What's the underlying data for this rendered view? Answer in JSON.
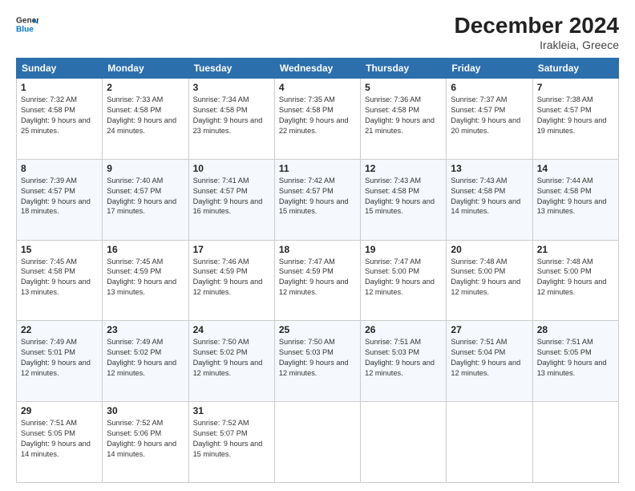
{
  "header": {
    "logo_general": "General",
    "logo_blue": "Blue",
    "title": "December 2024",
    "subtitle": "Irakleia, Greece"
  },
  "days_of_week": [
    "Sunday",
    "Monday",
    "Tuesday",
    "Wednesday",
    "Thursday",
    "Friday",
    "Saturday"
  ],
  "weeks": [
    [
      {
        "day": 1,
        "sunrise": "7:32 AM",
        "sunset": "4:58 PM",
        "daylight": "9 hours and 25 minutes."
      },
      {
        "day": 2,
        "sunrise": "7:33 AM",
        "sunset": "4:58 PM",
        "daylight": "9 hours and 24 minutes."
      },
      {
        "day": 3,
        "sunrise": "7:34 AM",
        "sunset": "4:58 PM",
        "daylight": "9 hours and 23 minutes."
      },
      {
        "day": 4,
        "sunrise": "7:35 AM",
        "sunset": "4:58 PM",
        "daylight": "9 hours and 22 minutes."
      },
      {
        "day": 5,
        "sunrise": "7:36 AM",
        "sunset": "4:58 PM",
        "daylight": "9 hours and 21 minutes."
      },
      {
        "day": 6,
        "sunrise": "7:37 AM",
        "sunset": "4:57 PM",
        "daylight": "9 hours and 20 minutes."
      },
      {
        "day": 7,
        "sunrise": "7:38 AM",
        "sunset": "4:57 PM",
        "daylight": "9 hours and 19 minutes."
      }
    ],
    [
      {
        "day": 8,
        "sunrise": "7:39 AM",
        "sunset": "4:57 PM",
        "daylight": "9 hours and 18 minutes."
      },
      {
        "day": 9,
        "sunrise": "7:40 AM",
        "sunset": "4:57 PM",
        "daylight": "9 hours and 17 minutes."
      },
      {
        "day": 10,
        "sunrise": "7:41 AM",
        "sunset": "4:57 PM",
        "daylight": "9 hours and 16 minutes."
      },
      {
        "day": 11,
        "sunrise": "7:42 AM",
        "sunset": "4:57 PM",
        "daylight": "9 hours and 15 minutes."
      },
      {
        "day": 12,
        "sunrise": "7:43 AM",
        "sunset": "4:58 PM",
        "daylight": "9 hours and 15 minutes."
      },
      {
        "day": 13,
        "sunrise": "7:43 AM",
        "sunset": "4:58 PM",
        "daylight": "9 hours and 14 minutes."
      },
      {
        "day": 14,
        "sunrise": "7:44 AM",
        "sunset": "4:58 PM",
        "daylight": "9 hours and 13 minutes."
      }
    ],
    [
      {
        "day": 15,
        "sunrise": "7:45 AM",
        "sunset": "4:58 PM",
        "daylight": "9 hours and 13 minutes."
      },
      {
        "day": 16,
        "sunrise": "7:45 AM",
        "sunset": "4:59 PM",
        "daylight": "9 hours and 13 minutes."
      },
      {
        "day": 17,
        "sunrise": "7:46 AM",
        "sunset": "4:59 PM",
        "daylight": "9 hours and 12 minutes."
      },
      {
        "day": 18,
        "sunrise": "7:47 AM",
        "sunset": "4:59 PM",
        "daylight": "9 hours and 12 minutes."
      },
      {
        "day": 19,
        "sunrise": "7:47 AM",
        "sunset": "5:00 PM",
        "daylight": "9 hours and 12 minutes."
      },
      {
        "day": 20,
        "sunrise": "7:48 AM",
        "sunset": "5:00 PM",
        "daylight": "9 hours and 12 minutes."
      },
      {
        "day": 21,
        "sunrise": "7:48 AM",
        "sunset": "5:00 PM",
        "daylight": "9 hours and 12 minutes."
      }
    ],
    [
      {
        "day": 22,
        "sunrise": "7:49 AM",
        "sunset": "5:01 PM",
        "daylight": "9 hours and 12 minutes."
      },
      {
        "day": 23,
        "sunrise": "7:49 AM",
        "sunset": "5:02 PM",
        "daylight": "9 hours and 12 minutes."
      },
      {
        "day": 24,
        "sunrise": "7:50 AM",
        "sunset": "5:02 PM",
        "daylight": "9 hours and 12 minutes."
      },
      {
        "day": 25,
        "sunrise": "7:50 AM",
        "sunset": "5:03 PM",
        "daylight": "9 hours and 12 minutes."
      },
      {
        "day": 26,
        "sunrise": "7:51 AM",
        "sunset": "5:03 PM",
        "daylight": "9 hours and 12 minutes."
      },
      {
        "day": 27,
        "sunrise": "7:51 AM",
        "sunset": "5:04 PM",
        "daylight": "9 hours and 12 minutes."
      },
      {
        "day": 28,
        "sunrise": "7:51 AM",
        "sunset": "5:05 PM",
        "daylight": "9 hours and 13 minutes."
      }
    ],
    [
      {
        "day": 29,
        "sunrise": "7:51 AM",
        "sunset": "5:05 PM",
        "daylight": "9 hours and 14 minutes."
      },
      {
        "day": 30,
        "sunrise": "7:52 AM",
        "sunset": "5:06 PM",
        "daylight": "9 hours and 14 minutes."
      },
      {
        "day": 31,
        "sunrise": "7:52 AM",
        "sunset": "5:07 PM",
        "daylight": "9 hours and 15 minutes."
      },
      null,
      null,
      null,
      null
    ]
  ]
}
